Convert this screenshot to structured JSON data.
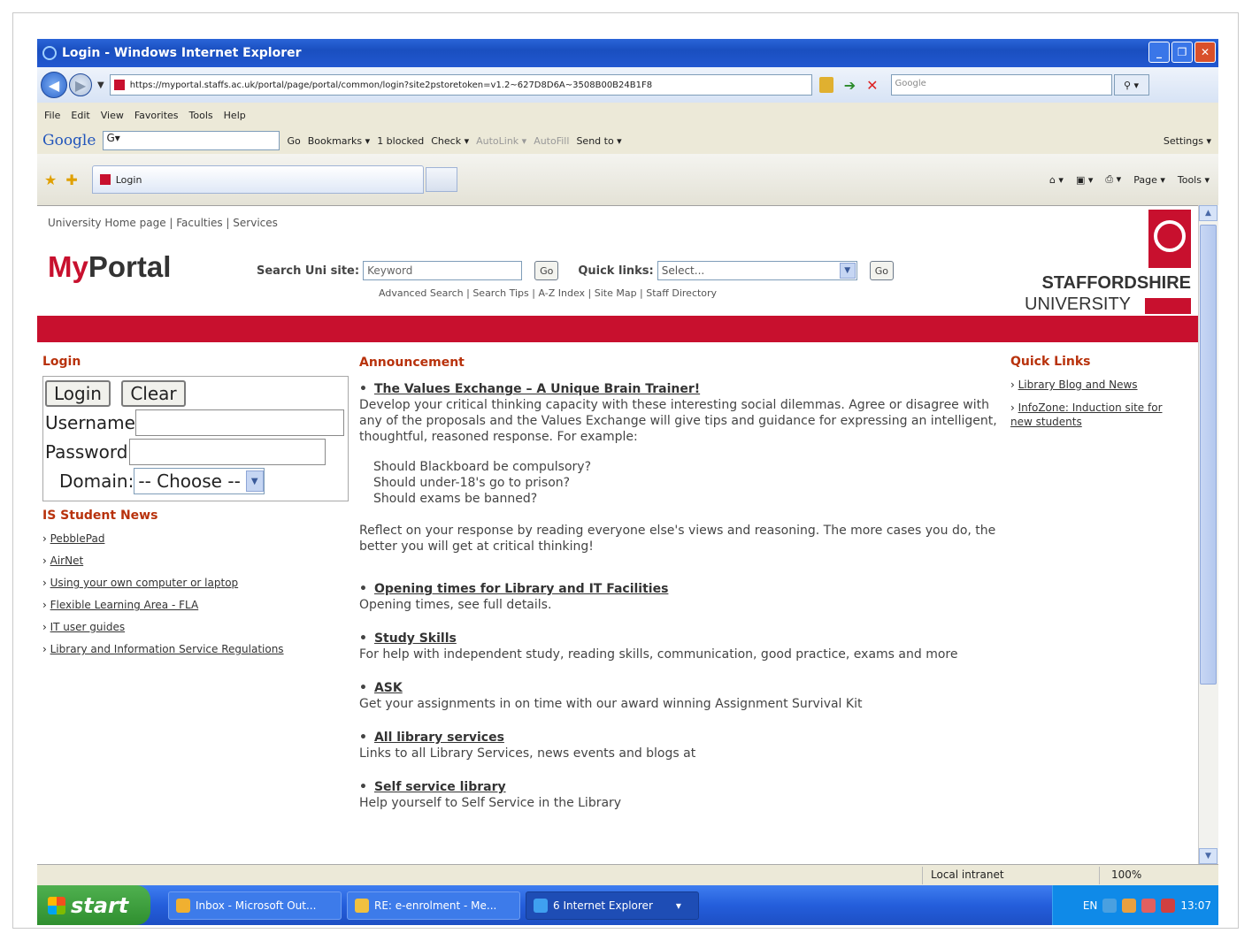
{
  "window": {
    "title": "Login - Windows Internet Explorer",
    "url": "https://myportal.staffs.ac.uk/portal/page/portal/common/login?site2pstoretoken=v1.2~627D8D6A~3508B00B24B1F8",
    "search_placeholder": "Google",
    "menu": [
      "File",
      "Edit",
      "View",
      "Favorites",
      "Tools",
      "Help"
    ],
    "tab_label": "Login"
  },
  "google_toolbar": {
    "logo": "Google",
    "box_text": "G▾",
    "go": "Go",
    "bookmarks": "Bookmarks ▾",
    "blocked": "1 blocked",
    "check": "Check ▾",
    "autolink": "AutoLink ▾",
    "autofill": "AutoFill",
    "sendto": "Send to ▾",
    "settings": "Settings ▾"
  },
  "command_bar": {
    "page": "Page ▾",
    "tools": "Tools ▾"
  },
  "page": {
    "top_links": "University Home page | Faculties | Services",
    "logo_my": "My",
    "logo_portal": "Portal",
    "search_label": "Search Uni site:",
    "search_placeholder": "Keyword",
    "go": "Go",
    "quick_links_label": "Quick links:",
    "quick_links_selected": "Select...",
    "sub_links": "Advanced Search | Search Tips | A-Z Index | Site Map | Staff Directory",
    "university_line1": "STAFFORDSHIRE",
    "university_line2": "UNIVERSITY"
  },
  "login": {
    "heading": "Login",
    "login_btn": "Login",
    "clear_btn": "Clear",
    "username_label": "Username",
    "password_label": "Password",
    "domain_label": "Domain:",
    "domain_value": "-- Choose --"
  },
  "student_news": {
    "heading": "IS Student News",
    "items": [
      "PebblePad",
      "AirNet",
      "Using your own computer or laptop",
      "Flexible Learning Area - FLA",
      "IT user guides",
      "Library and Information Service Regulations"
    ]
  },
  "announcement": {
    "heading": "Announcement",
    "item1_title": "The Values Exchange – A Unique Brain Trainer!",
    "item1_text": "Develop your critical thinking capacity with these interesting social dilemmas. Agree or disagree with any of the proposals and the Values Exchange will give tips and guidance for expressing an intelligent, thoughtful, reasoned response. For example:",
    "q1": "Should Blackboard be compulsory?",
    "q2": "Should under-18's go to prison?",
    "q3": "Should exams be banned?",
    "item1_outro": "Reflect on your response by reading everyone else's views and reasoning. The more cases you do, the better you will get at critical thinking!",
    "item2_title": "Opening times for Library and IT Facilities",
    "item2_text": "Opening times, see full details.",
    "item3_title": "Study Skills",
    "item3_text": "For help with independent study, reading skills, communication, good practice, exams and more",
    "item4_title": "ASK",
    "item4_text": "Get your assignments in on time with our award winning Assignment Survival Kit",
    "item5_title": "All library services",
    "item5_text": "Links to all Library Services, news events and blogs at",
    "item6_title": "Self service library",
    "item6_text": "Help yourself to Self Service in the Library"
  },
  "quick_links": {
    "heading": "Quick Links",
    "items": [
      "Library Blog and News",
      "InfoZone: Induction site for new students"
    ]
  },
  "statusbar": {
    "zone": "Local intranet",
    "zoom": "100%"
  },
  "taskbar": {
    "start": "start",
    "tasks": [
      "Inbox - Microsoft Out...",
      "RE: e-enrolment - Me...",
      "6 Internet Explorer"
    ],
    "lang": "EN",
    "clock": "13:07"
  }
}
